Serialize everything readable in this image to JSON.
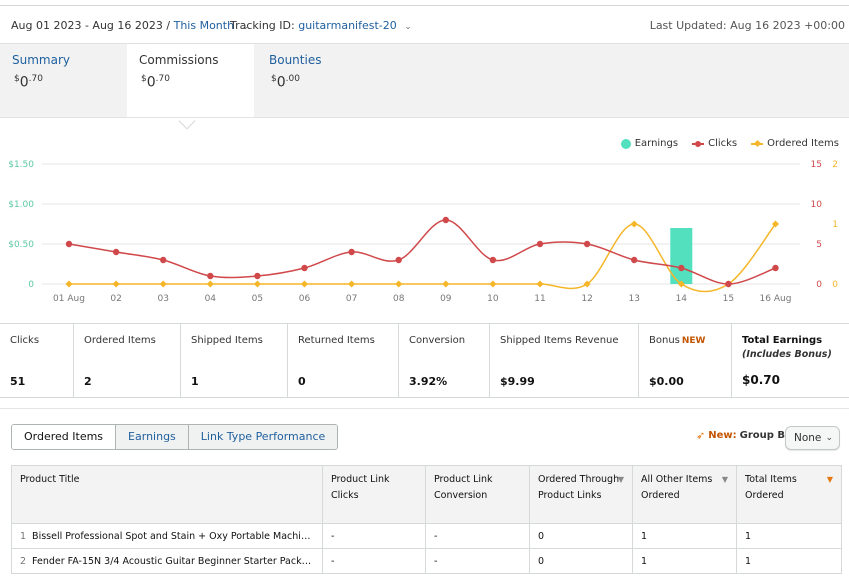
{
  "header": {
    "date_range": "Aug 01 2023 - Aug 16 2023",
    "separator": "/",
    "period": "This Month",
    "tracking_label": "Tracking ID:",
    "tracking_id": "guitarmanifest-20",
    "last_updated": "Last Updated: Aug 16 2023 +00:00"
  },
  "summary_tabs": [
    {
      "label": "Summary",
      "currency": "$",
      "whole": "0",
      "cents": ".70"
    },
    {
      "label": "Commissions",
      "currency": "$",
      "whole": "0",
      "cents": ".70"
    },
    {
      "label": "Bounties",
      "currency": "$",
      "whole": "0",
      "cents": ".00"
    }
  ],
  "legend": {
    "earnings": "Earnings",
    "clicks": "Clicks",
    "ordered": "Ordered Items"
  },
  "colors": {
    "earnings": "#52e0be",
    "clicks": "#d0484a",
    "ordered": "#f5b62a",
    "link": "#1f5f9e",
    "accent": "#e47911"
  },
  "chart_data": {
    "type": "line",
    "categories": [
      "01 Aug",
      "02",
      "03",
      "04",
      "05",
      "06",
      "07",
      "08",
      "09",
      "10",
      "11",
      "12",
      "13",
      "14",
      "15",
      "16 Aug"
    ],
    "y_left_ticks": [
      "$1.50",
      "$1.00",
      "$0.50",
      "0"
    ],
    "y_clicks_ticks": [
      "15",
      "10",
      "5",
      "0"
    ],
    "y_ordered_ticks": [
      "2",
      "1",
      "0"
    ],
    "ylim_earnings": [
      0,
      1.5
    ],
    "ylim_clicks": [
      0,
      15
    ],
    "ylim_ordered": [
      0,
      2
    ],
    "series": [
      {
        "name": "Earnings",
        "type": "bar",
        "values": [
          0,
          0,
          0,
          0,
          0,
          0,
          0,
          0,
          0,
          0,
          0,
          0,
          0,
          0.7,
          0,
          0
        ]
      },
      {
        "name": "Clicks",
        "type": "line",
        "values": [
          5,
          4,
          3,
          1,
          1,
          2,
          4,
          3,
          8,
          3,
          5,
          5,
          3,
          2,
          0,
          2
        ]
      },
      {
        "name": "Ordered Items",
        "type": "line",
        "values": [
          0,
          0,
          0,
          0,
          0,
          0,
          0,
          0,
          0,
          0,
          0,
          0,
          1,
          0,
          0,
          1
        ]
      }
    ]
  },
  "metrics": [
    {
      "label": "Clicks",
      "value": "51"
    },
    {
      "label": "Ordered Items",
      "value": "2"
    },
    {
      "label": "Shipped Items",
      "value": "1"
    },
    {
      "label": "Returned Items",
      "value": "0"
    },
    {
      "label": "Conversion",
      "value": "3.92%"
    },
    {
      "label": "Shipped Items Revenue",
      "value": "$9.99"
    },
    {
      "label": "Bonus",
      "badge": "NEW",
      "value": "$0.00"
    },
    {
      "label": "Total Earnings",
      "sub": "(Includes Bonus)",
      "value": "$0.70"
    }
  ],
  "report_tabs": [
    "Ordered Items",
    "Earnings",
    "Link Type Performance"
  ],
  "group_by": {
    "new": "New:",
    "label": "Group By:",
    "value": "None"
  },
  "table": {
    "headers": [
      "Product Title",
      "Product Link Clicks",
      "Product Link Conversion",
      "Ordered Through Product Links",
      "All Other Items Ordered",
      "Total Items Ordered"
    ],
    "rows": [
      {
        "index": "1",
        "title": "Bissell Professional Spot and Stain + Oxy Portable Machine ...",
        "clicks": "-",
        "conversion": "-",
        "ordered_links": "0",
        "other": "1",
        "total": "1"
      },
      {
        "index": "2",
        "title": "Fender FA-15N 3/4 Acoustic Guitar Beginner Starter Pack, ...",
        "clicks": "-",
        "conversion": "-",
        "ordered_links": "0",
        "other": "1",
        "total": "1"
      }
    ]
  }
}
